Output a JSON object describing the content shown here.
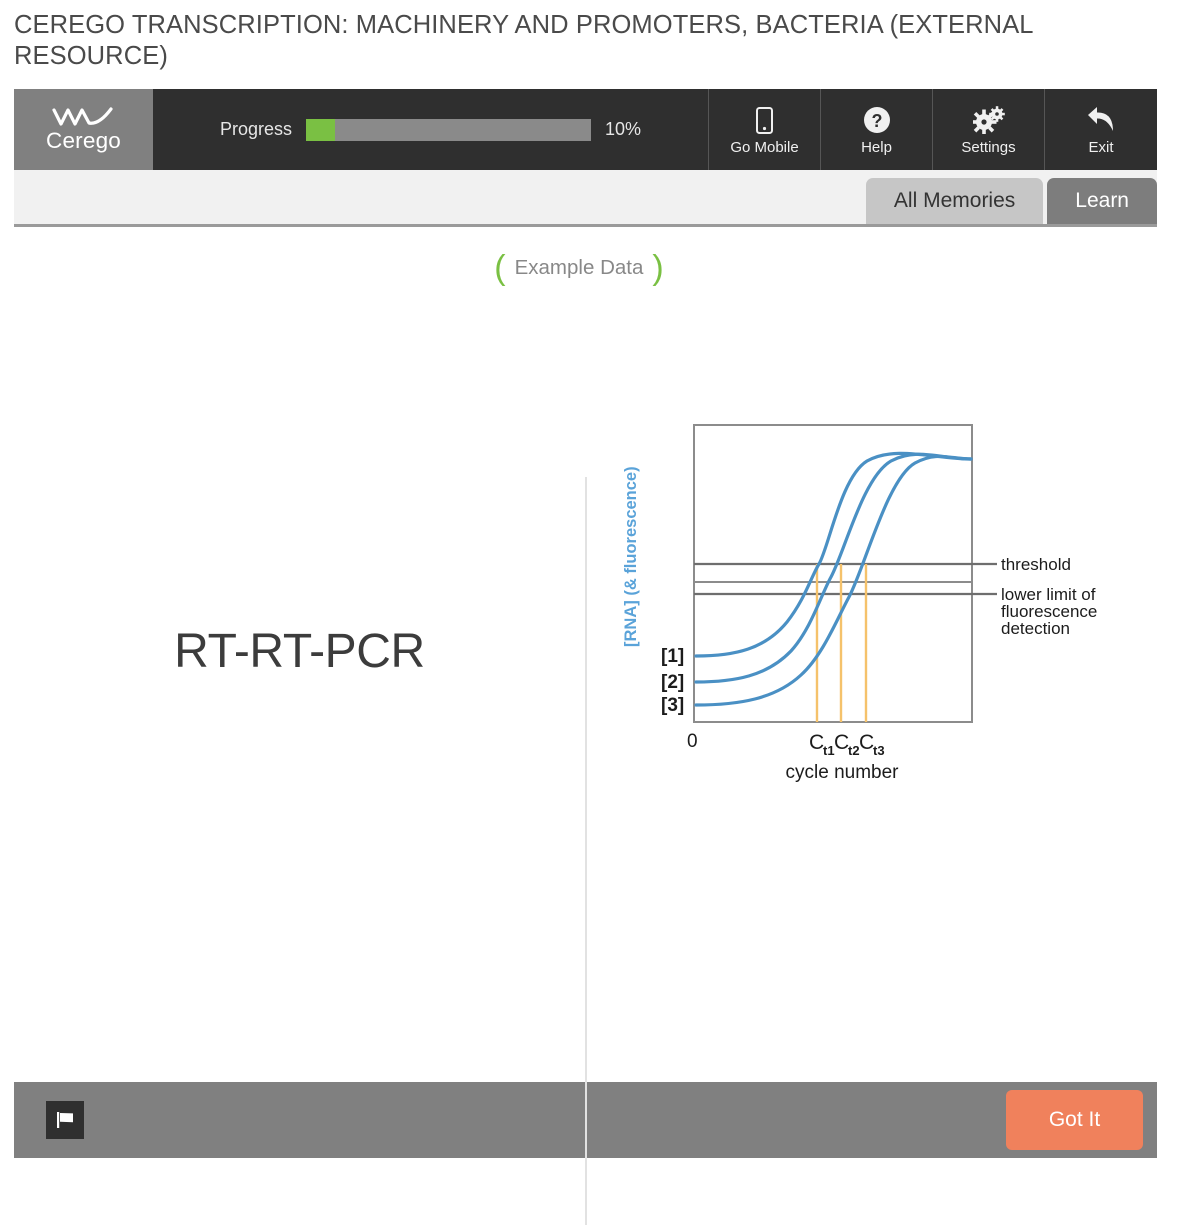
{
  "page": {
    "title": "CEREGO TRANSCRIPTION: MACHINERY AND PROMOTERS, BACTERIA (EXTERNAL RESOURCE)"
  },
  "toolbar": {
    "brand": "Cerego",
    "brand_logo_icon": "wave-squiggle-icon",
    "progress_label": "Progress",
    "progress_percent_text": "10%",
    "progress_percent": 10,
    "buttons": [
      {
        "label": "Go Mobile",
        "icon": "mobile-phone-icon"
      },
      {
        "label": "Help",
        "icon": "question-circle-icon"
      },
      {
        "label": "Settings",
        "icon": "gears-icon"
      },
      {
        "label": "Exit",
        "icon": "arrow-back-icon"
      }
    ]
  },
  "tabs": [
    {
      "label": "All Memories",
      "active": false
    },
    {
      "label": "Learn",
      "active": true
    }
  ],
  "content": {
    "badge_text": "Example Data",
    "badge_bracket_left": "(",
    "badge_bracket_right": ")",
    "prompt": "RT-RT-PCR"
  },
  "bottombar": {
    "flag_icon": "flag-icon",
    "primary_button": "Got It"
  },
  "colors": {
    "accent_green": "#7ac043",
    "toolbar_dark": "#2f2f2f",
    "logo_gray": "#808080",
    "active_tab": "#7d7d7d",
    "inactive_tab": "#c6c6c6",
    "got_it_orange": "#f0815c",
    "curve_blue": "#4a90c4",
    "axis_label_blue": "#5aa3d9",
    "ct_line_orange": "#f5c26b",
    "gridline_gray": "#8c8c8c"
  },
  "chart_data": {
    "type": "line",
    "title": "",
    "xlabel": "cycle number",
    "ylabel": "[RNA] (& fluorescence)",
    "xlim": [
      0,
      40
    ],
    "ylim": [
      0,
      1
    ],
    "grid": false,
    "legend": "inline-left-labels",
    "x_tick_labels": [
      "0"
    ],
    "series": [
      {
        "name": "[1]",
        "baseline": 0.26,
        "plateau": 0.915,
        "midpoint_cycle": 19.0,
        "ct_cycle": 17.4,
        "ct_label": "Ct1"
      },
      {
        "name": "[2]",
        "baseline": 0.17,
        "plateau": 0.915,
        "midpoint_cycle": 21.2,
        "ct_cycle": 19.6,
        "ct_label": "Ct2"
      },
      {
        "name": "[3]",
        "baseline": 0.09,
        "plateau": 0.915,
        "midpoint_cycle": 23.4,
        "ct_cycle": 21.9,
        "ct_label": "Ct3"
      }
    ],
    "series_labels": [
      "[1]",
      "[2]",
      "[3]"
    ],
    "ct_labels": [
      {
        "base": "C",
        "sub": "t1"
      },
      {
        "base": "C",
        "sub": "t2"
      },
      {
        "base": "C",
        "sub": "t3"
      }
    ],
    "hlines": [
      {
        "label": "threshold",
        "value": 0.6
      },
      {
        "label": "lower limit of fluorescence detection",
        "value": 0.51
      }
    ],
    "annotations": [
      {
        "text": "threshold",
        "lines": [
          "threshold"
        ]
      },
      {
        "text": "lower limit of fluorescence detection",
        "lines": [
          "lower limit of",
          "fluorescence",
          "detection"
        ]
      }
    ]
  }
}
